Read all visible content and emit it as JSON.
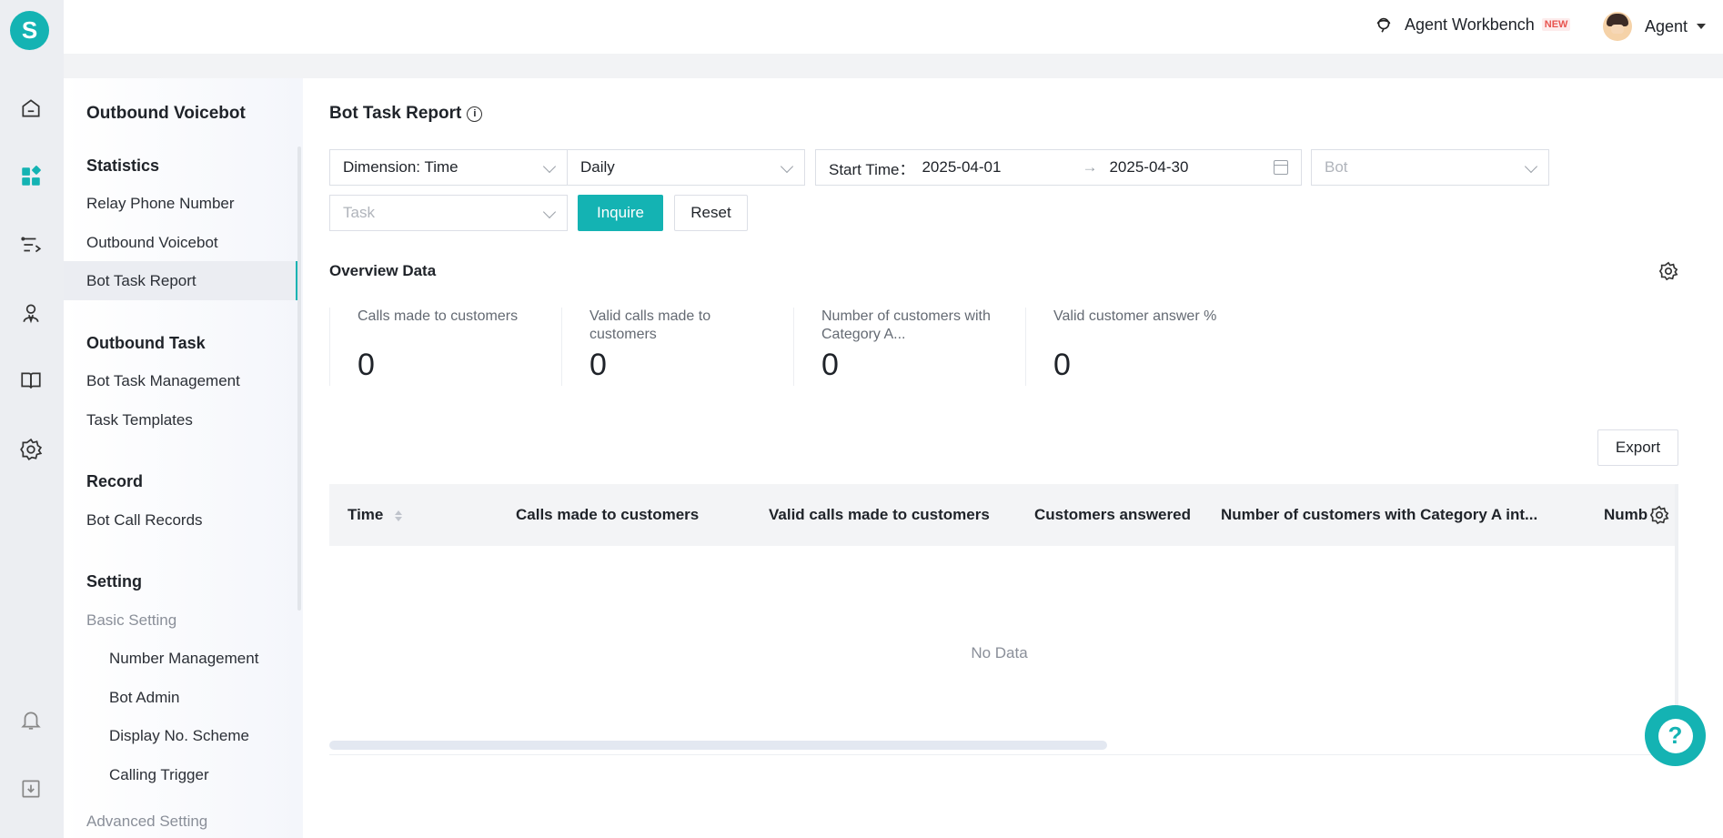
{
  "app": {
    "logo_letter": "S"
  },
  "rail": [
    "home-icon",
    "apps-icon",
    "route-icon",
    "agent-icon",
    "book-icon",
    "settings-icon",
    "bell-icon",
    "download-icon"
  ],
  "topbar": {
    "workbench_label": "Agent Workbench",
    "new_badge": "NEW",
    "user_label": "Agent"
  },
  "sidebar": {
    "title": "Outbound Voicebot",
    "groups": {
      "statistics": "Statistics",
      "outbound_task": "Outbound Task",
      "record": "Record",
      "setting": "Setting"
    },
    "items": {
      "relay_phone_number": "Relay Phone Number",
      "outbound_voicebot": "Outbound Voicebot",
      "bot_task_report": "Bot Task Report",
      "bot_task_management": "Bot Task Management",
      "task_templates": "Task Templates",
      "bot_call_records": "Bot Call Records",
      "basic_setting": "Basic Setting",
      "number_management": "Number Management",
      "bot_admin": "Bot Admin",
      "display_no_scheme": "Display No. Scheme",
      "calling_trigger": "Calling Trigger",
      "advanced_setting": "Advanced Setting"
    },
    "active": "Bot Task Report"
  },
  "main": {
    "title": "Bot Task Report",
    "filters": {
      "dimension": "Dimension: Time",
      "granularity": "Daily",
      "start_time_label": "Start Time：",
      "start_date": "2025-04-01",
      "end_date": "2025-04-30",
      "range_arrow": "→",
      "bot_placeholder": "Bot",
      "task_placeholder": "Task",
      "inquire": "Inquire",
      "reset": "Reset"
    },
    "overview": {
      "title": "Overview Data",
      "stats": [
        {
          "label": "Calls made to customers",
          "value": "0"
        },
        {
          "label": "Valid calls made to customers",
          "value": "0"
        },
        {
          "label": "Number of customers with Category A...",
          "value": "0"
        },
        {
          "label": "Valid customer answer %",
          "value": "0"
        }
      ]
    },
    "export": "Export",
    "table": {
      "columns": [
        "Time",
        "Calls made to customers",
        "Valid calls made to customers",
        "Customers answered",
        "Number of customers with Category A int...",
        "Numb"
      ],
      "empty_text": "No Data"
    }
  },
  "help_label": "?",
  "colors": {
    "accent": "#14b3b3",
    "new_badge": "#e8544f"
  }
}
